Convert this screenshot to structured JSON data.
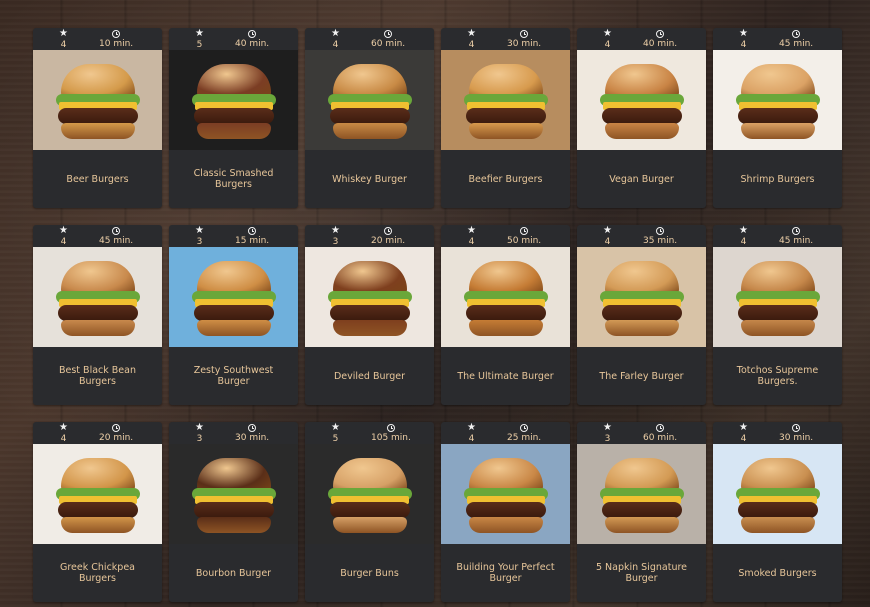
{
  "recipes": [
    {
      "title": "Beer Burgers",
      "rating": "4",
      "time": "10 min.",
      "bg": "#c9b7a2",
      "bun": "#d49a4a"
    },
    {
      "title": "Classic Smashed Burgers",
      "rating": "5",
      "time": "40 min.",
      "bg": "#1e1e1e",
      "bun": "#7b3d24"
    },
    {
      "title": "Whiskey Burger",
      "rating": "4",
      "time": "60 min.",
      "bg": "#3b3a38",
      "bun": "#c88a45"
    },
    {
      "title": "Beefier Burgers",
      "rating": "4",
      "time": "30 min.",
      "bg": "#b78d5f",
      "bun": "#d79a4d"
    },
    {
      "title": "Vegan Burger",
      "rating": "4",
      "time": "40 min.",
      "bg": "#efe8de",
      "bun": "#c98445"
    },
    {
      "title": "Shrimp Burgers",
      "rating": "4",
      "time": "45 min.",
      "bg": "#f3efe9",
      "bun": "#dba265"
    },
    {
      "title": "Best Black Bean Burgers",
      "rating": "4",
      "time": "45 min.",
      "bg": "#e6e1da",
      "bun": "#c8894c"
    },
    {
      "title": "Zesty Southwest Burger",
      "rating": "3",
      "time": "15 min.",
      "bg": "#6fb0dc",
      "bun": "#cf8e45"
    },
    {
      "title": "Deviled Burger",
      "rating": "3",
      "time": "20 min.",
      "bg": "#eee7e0",
      "bun": "#7e3f1e"
    },
    {
      "title": "The Ultimate Burger",
      "rating": "4",
      "time": "50 min.",
      "bg": "#e9e2d8",
      "bun": "#c57c35"
    },
    {
      "title": "The Farley Burger",
      "rating": "4",
      "time": "35 min.",
      "bg": "#d8c3a7",
      "bun": "#d39a56"
    },
    {
      "title": "Totchos Supreme Burgers.",
      "rating": "4",
      "time": "45 min.",
      "bg": "#ddd6cf",
      "bun": "#c5874a"
    },
    {
      "title": "Greek Chickpea Burgers",
      "rating": "4",
      "time": "20 min.",
      "bg": "#f0ece6",
      "bun": "#d29549"
    },
    {
      "title": "Bourbon Burger",
      "rating": "3",
      "time": "30 min.",
      "bg": "#2a2a2a",
      "bun": "#5a2e18"
    },
    {
      "title": "Burger Buns",
      "rating": "5",
      "time": "105 min.",
      "bg": "#2b2b2b",
      "bun": "#d6a066"
    },
    {
      "title": "Building Your Perfect Burger",
      "rating": "4",
      "time": "25 min.",
      "bg": "#8aa6c2",
      "bun": "#c98746"
    },
    {
      "title": "5 Napkin Signature Burger",
      "rating": "3",
      "time": "60 min.",
      "bg": "#b9b1a8",
      "bun": "#d39a54"
    },
    {
      "title": "Smoked Burgers",
      "rating": "4",
      "time": "30 min.",
      "bg": "#d7e6f4",
      "bun": "#c98f50"
    }
  ],
  "icons": {
    "rating": "star-icon",
    "time": "clock-icon"
  }
}
